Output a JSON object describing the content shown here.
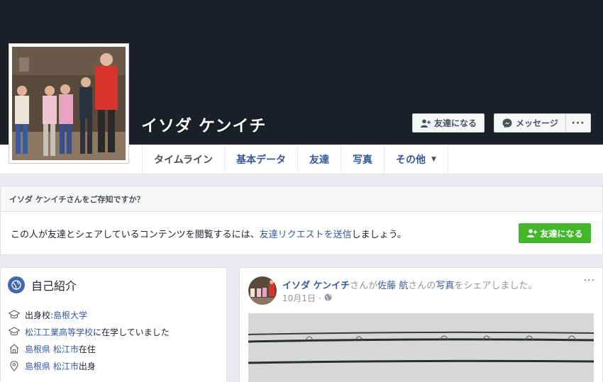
{
  "profile": {
    "name": "イソダ ケンイチ",
    "buttons": {
      "add_friend": "友達になる",
      "message": "メッセージ",
      "more": "···"
    }
  },
  "tabs": [
    {
      "label": "タイムライン",
      "active": true
    },
    {
      "label": "基本データ",
      "active": false
    },
    {
      "label": "友達",
      "active": false
    },
    {
      "label": "写真",
      "active": false
    },
    {
      "label": "その他",
      "active": false
    }
  ],
  "know_box": {
    "heading": "イソダ ケンイチさんをご存知ですか？",
    "text_before": "この人が友達とシェアしているコンテンツを閲覧するには、",
    "link_text": "友達リクエストを送信",
    "text_after": "しましょう。",
    "button_label": "友達になる"
  },
  "intro": {
    "title": "自己紹介",
    "items": [
      {
        "icon": "graduation-cap-icon",
        "prefix": "出身校: ",
        "link": "島根大学",
        "suffix": ""
      },
      {
        "icon": "graduation-cap-icon",
        "prefix": "",
        "link": "松江工業高等学校",
        "suffix": "に在学していました"
      },
      {
        "icon": "home-icon",
        "prefix": "",
        "link": "島根県 松江市",
        "suffix": "在住"
      },
      {
        "icon": "location-pin-icon",
        "prefix": "",
        "link": "島根県 松江市",
        "suffix": "出身"
      }
    ]
  },
  "post": {
    "author": "イソダ ケンイチ",
    "text1": "さんが",
    "other_user": "佐藤 航",
    "text2": "さんの",
    "photo_link": "写真",
    "text3": "をシェアしました。",
    "date": "10月1日",
    "sep": "·",
    "options": "···"
  },
  "colors": {
    "cover": "#1d2029",
    "link": "#365899",
    "green_button": "#42b72a",
    "background": "#e9ebee"
  }
}
